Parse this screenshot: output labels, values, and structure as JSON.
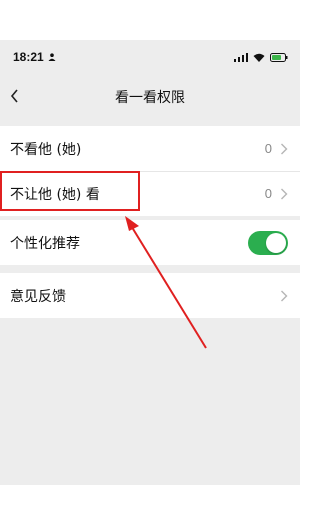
{
  "status_bar": {
    "time": "18:21",
    "icons": [
      "person-icon",
      "signal-icon",
      "wifi-icon",
      "battery-icon"
    ]
  },
  "nav": {
    "back_icon": "chevron-left-icon",
    "title": "看一看权限"
  },
  "group1": {
    "rows": [
      {
        "label": "不看他 (她)",
        "value": "0",
        "icon": "chevron-right-icon"
      },
      {
        "label": "不让他 (她) 看",
        "value": "0",
        "icon": "chevron-right-icon"
      }
    ]
  },
  "group2": {
    "rows": [
      {
        "label": "个性化推荐",
        "toggle_on": true
      }
    ]
  },
  "group3": {
    "rows": [
      {
        "label": "意见反馈",
        "icon": "chevron-right-icon"
      }
    ]
  },
  "colors": {
    "toggle_on": "#2bae4f",
    "highlight": "#e02020",
    "background": "#ededed"
  }
}
